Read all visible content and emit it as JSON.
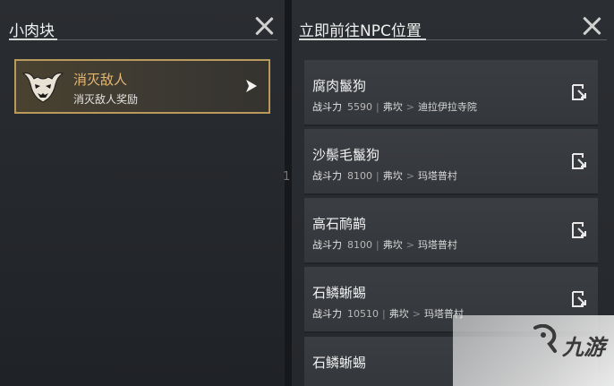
{
  "left_panel": {
    "title": "小肉块",
    "quest": {
      "title": "消灭敌人",
      "subtitle": "消灭敌人奖励"
    }
  },
  "divider_number": "1",
  "right_panel": {
    "title": "立即前往NPC位置",
    "npcs": [
      {
        "name": "腐肉鬣狗",
        "power_label": "战斗力",
        "power": "5590",
        "region": "弗坎",
        "location": "迪拉伊拉寺院"
      },
      {
        "name": "沙鬃毛鬣狗",
        "power_label": "战斗力",
        "power": "8100",
        "region": "弗坎",
        "location": "玛塔普村"
      },
      {
        "name": "高石鸸鹋",
        "power_label": "战斗力",
        "power": "8100",
        "region": "弗坎",
        "location": "玛塔普村"
      },
      {
        "name": "石鳞蜥蜴",
        "power_label": "战斗力",
        "power": "10510",
        "region": "弗坎",
        "location": "玛塔普村"
      },
      {
        "name": "石鳞蜥蜴"
      }
    ]
  },
  "watermark": {
    "text": "九游"
  },
  "colors": {
    "accent": "#e6b870",
    "card_border": "#b99a5a"
  }
}
